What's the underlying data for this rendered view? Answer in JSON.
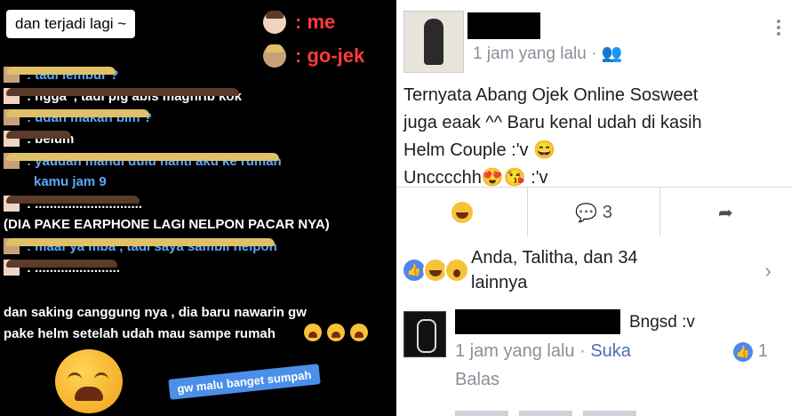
{
  "story": {
    "title": "dan terjadi lagi ~",
    "legend": [
      {
        "who": "me",
        "label": ": me"
      },
      {
        "who": "go-jek",
        "label": ": go-jek"
      }
    ],
    "chat": [
      {
        "who": "go-jek",
        "text": ": tadi lembur ?"
      },
      {
        "who": "me",
        "text": ": ngga' , tadi plg abis maghrib kok"
      },
      {
        "who": "go-jek",
        "text": ": udah makan blm ?"
      },
      {
        "who": "me",
        "text": ": belum"
      },
      {
        "who": "go-jek",
        "text": ": yaudah mandi dulu nanti aku ke rumah"
      },
      {
        "who": "go-jek",
        "text": "kamu jam 9"
      },
      {
        "who": "me",
        "text": ": ............................."
      },
      {
        "who": "none",
        "text": "(DIA PAKE EARPHONE LAGI NELPON PACAR NYA)"
      },
      {
        "who": "go-jek",
        "text": ": maaf ya mba , tadi saya sambil nelpon"
      },
      {
        "who": "me",
        "text": ": ......................."
      }
    ],
    "closing_line1": "dan saking canggung nya , dia baru nawarin gw",
    "closing_line2": "pake helm setelah udah mau sampe rumah",
    "sticker": "gw malu banget sumpah",
    "colors": {
      "legend": "#ff3b3b",
      "gojek_text": "#5aa8ff",
      "background": "#000000"
    }
  },
  "post": {
    "time": "1 jam yang lalu",
    "audience_icon": "friends-icon",
    "text_lines": [
      "Ternyata Abang Ojek Online Sosweet",
      "juga eaak ^^ Baru kenal udah di kasih",
      "Helm Couple :'v 😄",
      "Uncccchh😍😘 :'v"
    ],
    "comment_count": "3",
    "reactions_text_line1": "Anda, Talitha, dan 34",
    "reactions_text_line2": "lainnya",
    "comment": {
      "name_suffix": "Bngsd :v",
      "time": "1 jam yang lalu",
      "like_label": "Suka",
      "like_count": "1",
      "reply_label": "Balas"
    },
    "colors": {
      "like_blue": "#4f86ec",
      "meta_gray": "#8a8f98"
    }
  }
}
